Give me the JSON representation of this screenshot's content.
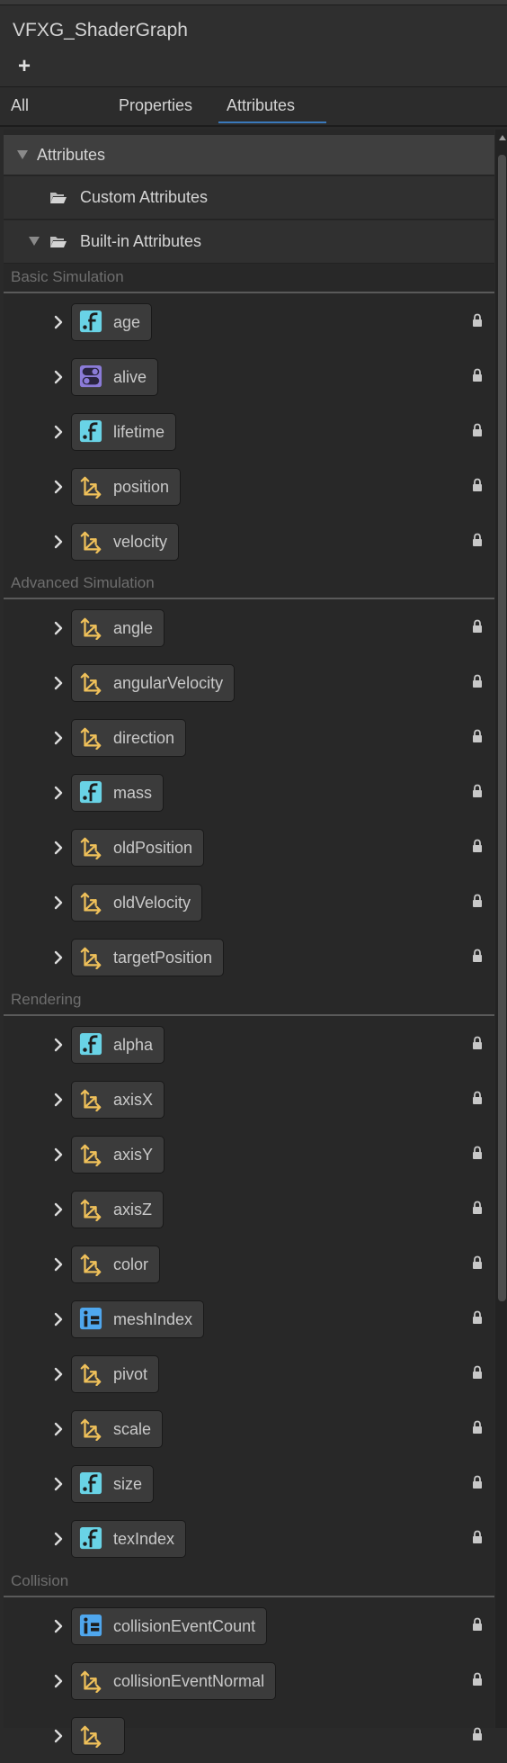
{
  "window": {
    "title": "VFXG_ShaderGraph",
    "add_label": "+"
  },
  "tabs": [
    {
      "label": "All",
      "active": false
    },
    {
      "label": "Properties",
      "active": false
    },
    {
      "label": "Attributes",
      "active": true
    }
  ],
  "tree": {
    "root_label": "Attributes",
    "custom_label": "Custom Attributes",
    "builtin_label": "Built-in Attributes"
  },
  "colors": {
    "float_icon": "#69d3e6",
    "bool_icon": "#8b7bd8",
    "vector_icon": "#f0c15a",
    "uint_icon": "#4fa7ee",
    "tab_underline": "#3a79bb"
  },
  "categories": [
    {
      "name": "Basic Simulation",
      "items": [
        {
          "name": "age",
          "type": "float"
        },
        {
          "name": "alive",
          "type": "bool"
        },
        {
          "name": "lifetime",
          "type": "float"
        },
        {
          "name": "position",
          "type": "vector"
        },
        {
          "name": "velocity",
          "type": "vector"
        }
      ]
    },
    {
      "name": "Advanced Simulation",
      "items": [
        {
          "name": "angle",
          "type": "vector"
        },
        {
          "name": "angularVelocity",
          "type": "vector"
        },
        {
          "name": "direction",
          "type": "vector"
        },
        {
          "name": "mass",
          "type": "float"
        },
        {
          "name": "oldPosition",
          "type": "vector"
        },
        {
          "name": "oldVelocity",
          "type": "vector"
        },
        {
          "name": "targetPosition",
          "type": "vector"
        }
      ]
    },
    {
      "name": "Rendering",
      "items": [
        {
          "name": "alpha",
          "type": "float"
        },
        {
          "name": "axisX",
          "type": "vector"
        },
        {
          "name": "axisY",
          "type": "vector"
        },
        {
          "name": "axisZ",
          "type": "vector"
        },
        {
          "name": "color",
          "type": "vector"
        },
        {
          "name": "meshIndex",
          "type": "uint"
        },
        {
          "name": "pivot",
          "type": "vector"
        },
        {
          "name": "scale",
          "type": "vector"
        },
        {
          "name": "size",
          "type": "float"
        },
        {
          "name": "texIndex",
          "type": "float"
        }
      ]
    },
    {
      "name": "Collision",
      "items": [
        {
          "name": "collisionEventCount",
          "type": "uint"
        },
        {
          "name": "collisionEventNormal",
          "type": "vector"
        },
        {
          "name": "",
          "type": "vector"
        }
      ]
    }
  ]
}
